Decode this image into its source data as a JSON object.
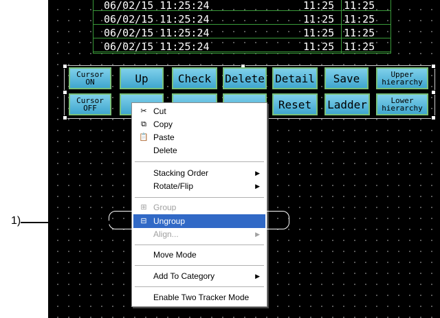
{
  "log_rows": [
    {
      "datetime": "06/02/15 11:25:24",
      "time1": "11:25",
      "time2": "11:25"
    },
    {
      "datetime": "06/02/15 11:25:24",
      "time1": "11:25",
      "time2": "11:25"
    },
    {
      "datetime": "06/02/15 11:25:24",
      "time1": "11:25",
      "time2": "11:25"
    },
    {
      "datetime": "06/02/15 11:25:24",
      "time1": "11:25",
      "time2": "11:25"
    }
  ],
  "buttons_row1": [
    {
      "line1": "Cursor",
      "line2": "ON"
    },
    {
      "label": "Up"
    },
    {
      "label": "Check"
    },
    {
      "label": "Delete"
    },
    {
      "label": "Detail"
    },
    {
      "label": "Save"
    },
    {
      "line1": "Upper",
      "line2": "hierarchy"
    }
  ],
  "buttons_row2": [
    {
      "line1": "Cursor",
      "line2": "OFF"
    },
    {
      "label": "Reset"
    },
    {
      "label": "Ladder"
    },
    {
      "line1": "Lower",
      "line2": "hierarchy"
    }
  ],
  "context_menu": {
    "cut": "Cut",
    "copy": "Copy",
    "paste": "Paste",
    "delete": "Delete",
    "stacking_order": "Stacking Order",
    "rotate_flip": "Rotate/Flip",
    "group": "Group",
    "ungroup": "Ungroup",
    "align": "Align...",
    "move_mode": "Move Mode",
    "add_to_category": "Add To Category",
    "enable_two_tracker": "Enable Two Tracker Mode"
  },
  "callout": {
    "label": "1)"
  },
  "colors": {
    "canvas": "#000000",
    "button": "#5bbce0",
    "button_border": "#7ac17a",
    "highlight": "#3169c6"
  }
}
